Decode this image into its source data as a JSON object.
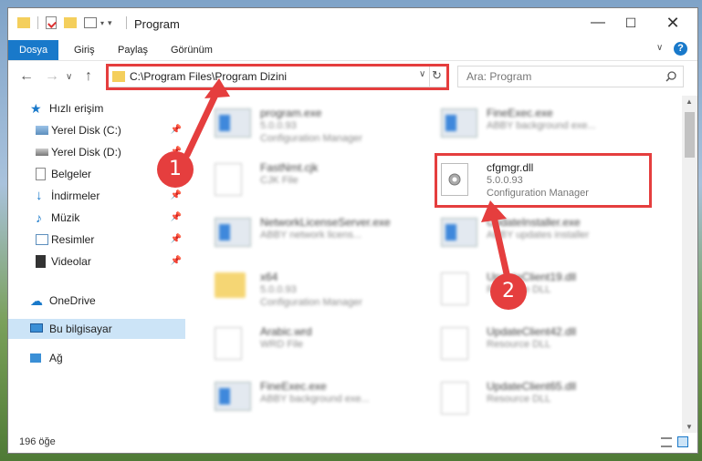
{
  "window": {
    "title": "Program"
  },
  "ribbon": {
    "tabs": [
      "Dosya",
      "Giriş",
      "Paylaş",
      "Görünüm"
    ]
  },
  "address": {
    "path": "C:\\Program Files\\Program Dizini",
    "search_placeholder": "Ara: Program"
  },
  "nav": {
    "quick_access": "Hızlı erişim",
    "items": [
      {
        "label": "Yerel Disk (C:)",
        "pinned": true
      },
      {
        "label": "Yerel Disk (D:)",
        "pinned": true
      },
      {
        "label": "Belgeler",
        "pinned": true
      },
      {
        "label": "İndirmeler",
        "pinned": true
      },
      {
        "label": "Müzik",
        "pinned": true
      },
      {
        "label": "Resimler",
        "pinned": true
      },
      {
        "label": "Videolar",
        "pinned": true
      }
    ],
    "onedrive": "OneDrive",
    "this_pc": "Bu bilgisayar",
    "network": "Ağ"
  },
  "files": [
    {
      "name": "program.exe",
      "line2": "5.0.0.93",
      "line3": "Configuration Manager",
      "type": "exe"
    },
    {
      "name": "FineExec.exe",
      "line2": "ABBY background exe...",
      "line3": "",
      "type": "exe"
    },
    {
      "name": "FastNmt.cjk",
      "line2": "CJK File",
      "line3": "",
      "type": "file"
    },
    {
      "name": "cfgmgr.dll",
      "line2": "5.0.0.93",
      "line3": "Configuration Manager",
      "type": "dll"
    },
    {
      "name": "NetworkLicenseServer.exe",
      "line2": "ABBY network licens...",
      "line3": "",
      "type": "exe"
    },
    {
      "name": "UpdateInstaller.exe",
      "line2": "ABBY updates installer",
      "line3": "",
      "type": "exe"
    },
    {
      "name": "x64",
      "line2": "5.0.0.93",
      "line3": "Configuration Manager",
      "type": "folder"
    },
    {
      "name": "UpdateClient19.dll",
      "line2": "Resource DLL",
      "line3": "",
      "type": "dll"
    },
    {
      "name": "Arabic.wrd",
      "line2": "WRD File",
      "line3": "",
      "type": "file"
    },
    {
      "name": "UpdateClient42.dll",
      "line2": "Resource DLL",
      "line3": "",
      "type": "dll"
    },
    {
      "name": "FineExec.exe",
      "line2": "ABBY background exe...",
      "line3": "",
      "type": "exe"
    },
    {
      "name": "UpdateClient65.dll",
      "line2": "Resource DLL",
      "line3": "",
      "type": "dll"
    }
  ],
  "status": {
    "count": "196 öğe"
  },
  "callouts": [
    "1",
    "2"
  ],
  "icons": {
    "titlebar": [
      "folder-icon",
      "properties-icon",
      "new-folder-icon",
      "view-icon"
    ]
  }
}
